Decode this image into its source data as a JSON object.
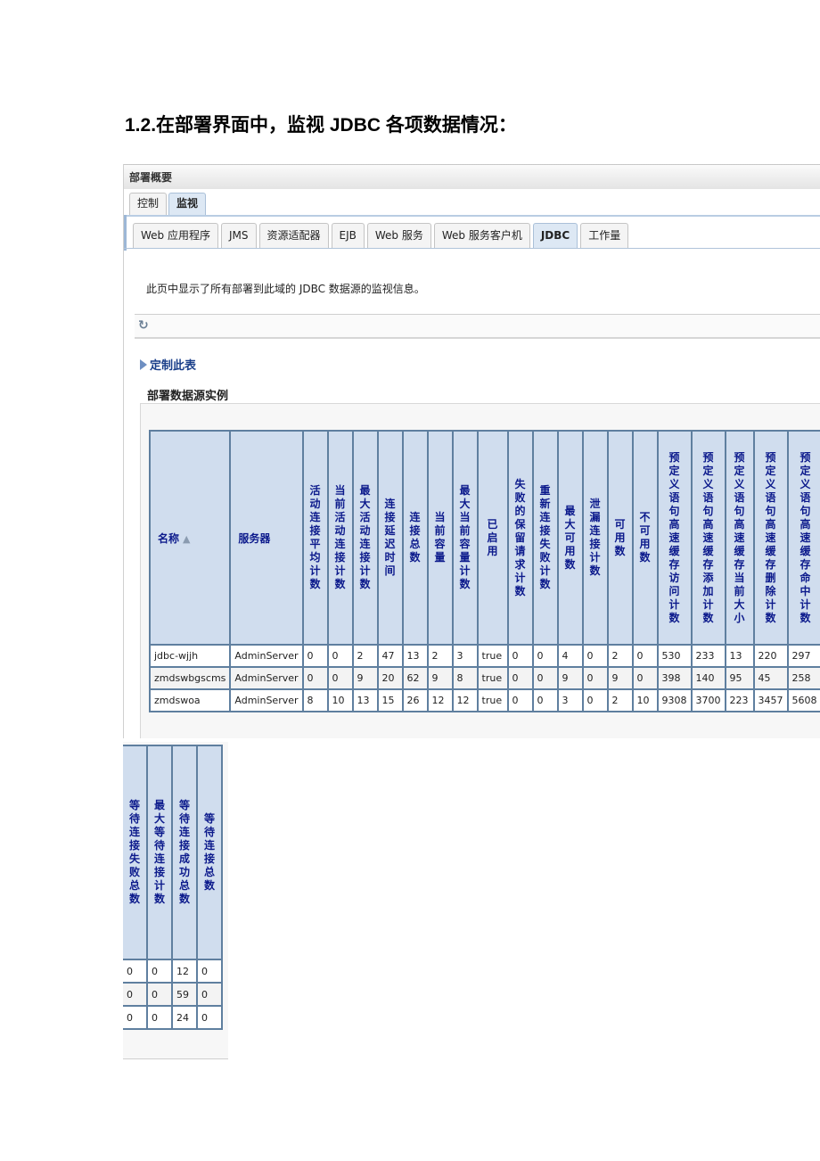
{
  "document": {
    "heading": "1.2.在部署界面中，监视 JDBC 各项数据情况："
  },
  "console": {
    "summary_title": "部署概要",
    "top_tabs": [
      {
        "label": "控制",
        "active": false
      },
      {
        "label": "监视",
        "active": true
      }
    ],
    "sub_tabs": [
      {
        "label": "Web 应用程序",
        "active": false
      },
      {
        "label": "JMS",
        "active": false
      },
      {
        "label": "资源适配器",
        "active": false
      },
      {
        "label": "EJB",
        "active": false
      },
      {
        "label": "Web 服务",
        "active": false
      },
      {
        "label": "Web 服务客户机",
        "active": false
      },
      {
        "label": "JDBC",
        "active": true
      },
      {
        "label": "工作量",
        "active": false
      }
    ],
    "description": "此页中显示了所有部署到此域的 JDBC 数据源的监视信息。",
    "refresh_icon": "refresh-icon",
    "customize_label": "定制此表",
    "section_title": "部署数据源实例",
    "table": {
      "columns": [
        "名称",
        "服务器",
        "活动连接平均计数",
        "当前活动连接计数",
        "最大活动连接计数",
        "连接延迟时间",
        "连接总数",
        "当前容量",
        "最大当前容量计数",
        "已启用",
        "失败的保留请求计数",
        "重新连接失败计数",
        "最大可用数",
        "泄漏连接计数",
        "可用数",
        "不可用数",
        "预定义语句高速缓存访问计数",
        "预定义语句高速缓存添加计数",
        "预定义语句高速缓存当前大小",
        "预定义语句高速缓存删除计数",
        "预定义语句高速缓存命中计数"
      ],
      "rows": [
        [
          "jdbc-wjjh",
          "AdminServer",
          "0",
          "0",
          "2",
          "47",
          "13",
          "2",
          "3",
          "true",
          "0",
          "0",
          "4",
          "0",
          "2",
          "0",
          "530",
          "233",
          "13",
          "220",
          "297"
        ],
        [
          "zmdswbgscms",
          "AdminServer",
          "0",
          "0",
          "9",
          "20",
          "62",
          "9",
          "8",
          "true",
          "0",
          "0",
          "9",
          "0",
          "9",
          "0",
          "398",
          "140",
          "95",
          "45",
          "258"
        ],
        [
          "zmdswoa",
          "AdminServer",
          "8",
          "10",
          "13",
          "15",
          "26",
          "12",
          "12",
          "true",
          "0",
          "0",
          "3",
          "0",
          "2",
          "10",
          "9308",
          "3700",
          "223",
          "3457",
          "5608"
        ]
      ]
    },
    "continuation_table": {
      "columns": [
        "等待连接失败总数",
        "最大等待连接计数",
        "等待连接成功总数",
        "等待连接总数"
      ],
      "rows": [
        [
          "0",
          "0",
          "12",
          "0"
        ],
        [
          "0",
          "0",
          "59",
          "0"
        ],
        [
          "0",
          "0",
          "24",
          "0"
        ]
      ]
    }
  }
}
